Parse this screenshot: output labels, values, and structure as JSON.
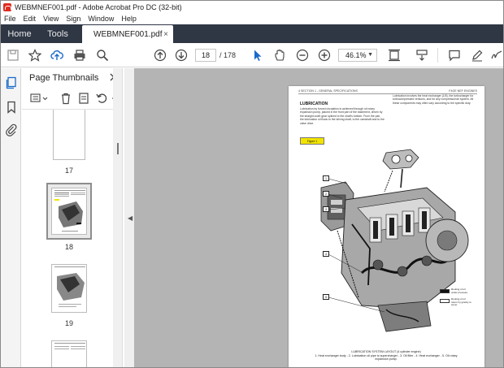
{
  "window": {
    "title": "WEBMNEF001.pdf - Adobe Acrobat Pro DC (32-bit)"
  },
  "menu": [
    "File",
    "Edit",
    "View",
    "Sign",
    "Window",
    "Help"
  ],
  "tabs": {
    "home": "Home",
    "tools": "Tools",
    "document": "WEBMNEF001.pdf",
    "close_glyph": "×"
  },
  "toolbar": {
    "current_page": "18",
    "total_pages": "/ 178",
    "zoom": "46.1%"
  },
  "thumbnails": {
    "title": "Page Thumbnails",
    "pages": [
      {
        "label": "17"
      },
      {
        "label": "18",
        "selected": true
      },
      {
        "label": "19"
      }
    ]
  },
  "document_page": {
    "header_left": "4   SECTION 1 - GENERAL SPECIFICATIONS",
    "header_right": "F4GE NEF ENGINES",
    "heading": "LUBRICATION",
    "col1": "Lubrication by forced circulation is achieved through oil rotary expansion pump, placed in the front part of the basement, driven by the straight-tooth gear splined to the shaft's bottom. From the pan, the lubrication oil flows to the driving shaft, to the camshaft and to the valve drive.",
    "col2": "Lubrication involves the heat exchanger (1/5), the turbocharger for turbocompressed versions, and for any compressor/air system. All these components may often vary according to the specific duty.",
    "figure_label": "Figure 1",
    "legend_1": "Routing of oil under pressure",
    "legend_2": "Routing of oil return by gravity to sump",
    "caption_title": "LUBRICATION SYSTEM LAYOUT (4 cylinder engine)",
    "caption_text": "1. Heat exchanger body - 2. Lubrication oil pipe to supercharger - 3. Oil filter - 4. Heat exchanger - 5. Oil rotary expansion pump.",
    "callouts": [
      "1",
      "2",
      "3",
      "4",
      "5"
    ]
  },
  "colors": {
    "tab_bar": "#2f3745",
    "doc_bg": "#b4b4b4",
    "figure_label": "#f2e400",
    "acrobat_red": "#e02b20",
    "accent_blue": "#1b6ac9"
  }
}
